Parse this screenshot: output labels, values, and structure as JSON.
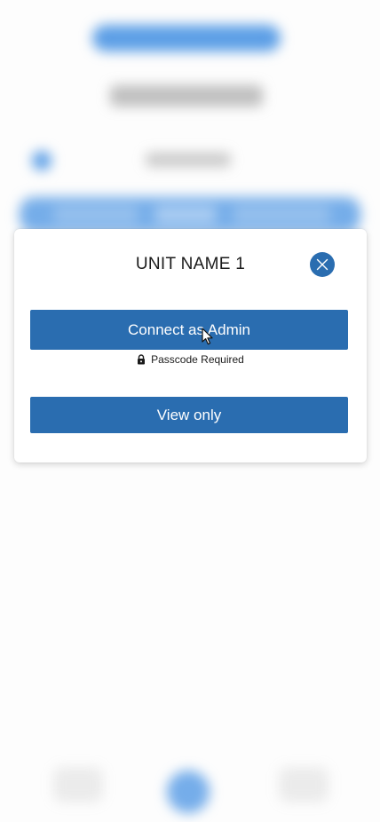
{
  "theme": {
    "accent": "#2a6db0",
    "background_blue": "#5d9fe6"
  },
  "dialog": {
    "title": "UNIT NAME 1",
    "close_icon": "close-icon",
    "admin_button_label": "Connect as Admin",
    "passcode_note": "Passcode Required",
    "lock_icon": "lock-icon",
    "view_button_label": "View only"
  }
}
